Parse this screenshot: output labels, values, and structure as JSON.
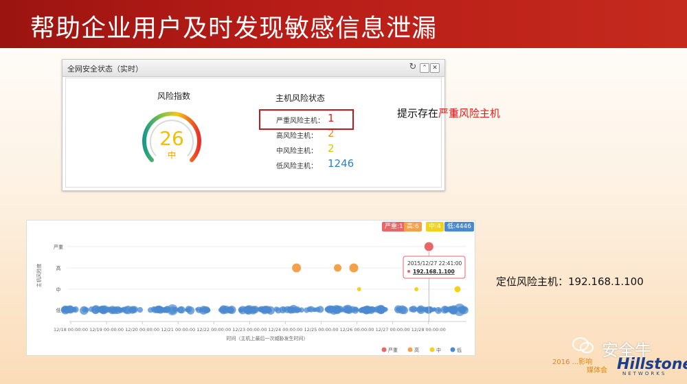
{
  "header": {
    "title": "帮助企业用户及时发现敏感信息泄漏"
  },
  "status_panel": {
    "title": "全网安全状态（实时）",
    "risk_index_label": "风险指数",
    "risk_value": "26",
    "risk_level": "中",
    "host_status_title": "主机风险状态",
    "rows": [
      {
        "label": "严重风险主机：",
        "value": "1",
        "color": "#e21b1b"
      },
      {
        "label": "高风险主机：",
        "value": "2",
        "color": "#f28a1c"
      },
      {
        "label": "中风险主机：",
        "value": "2",
        "color": "#e8c000"
      },
      {
        "label": "低风险主机：",
        "value": "1246",
        "color": "#2f7fc8"
      }
    ]
  },
  "note1": {
    "prefix": "提示存在",
    "highlight": "严重风险主机"
  },
  "note2": {
    "text": "定位风险主机：192.168.1.100"
  },
  "chart_data": {
    "type": "scatter",
    "badges": [
      {
        "text": "严重:1",
        "color": "#e8656a"
      },
      {
        "text": "高:6",
        "color": "#f5a04a"
      },
      {
        "text": "中:4",
        "color": "#f2d21a"
      },
      {
        "text": "低:4446",
        "color": "#4b8ad0"
      }
    ],
    "y_categories": [
      "低",
      "中",
      "高",
      "严重"
    ],
    "ylabel": "主机风险度",
    "xlabel": "时间（主机上最后一次威胁发生时间）",
    "x_ticks": [
      "12/18 00:00:00",
      "12/19 00:00:00",
      "12/20 00:00:00",
      "12/21 00:00:00",
      "12/22 00:00:00",
      "12/23 00:00:00",
      "12/24 00:00:00",
      "12/25 00:00:00",
      "12/26 00:00:00",
      "12/27 00:00:00",
      "12/28 00:00:00"
    ],
    "legend": [
      "严重",
      "高",
      "中",
      "低"
    ],
    "legend_colors": [
      "#e8656a",
      "#f5a04a",
      "#f2d21a",
      "#4b8ad0"
    ],
    "series": [
      {
        "name": "严重",
        "color": "#e8656a",
        "points": [
          {
            "x": 10.05,
            "size": 7
          }
        ]
      },
      {
        "name": "高",
        "color": "#f5a04a",
        "points": [
          {
            "x": 6.35,
            "size": 7
          },
          {
            "x": 7.5,
            "size": 6
          },
          {
            "x": 7.95,
            "size": 7
          }
        ]
      },
      {
        "name": "中",
        "color": "#f2d21a",
        "points": [
          {
            "x": 8.1,
            "size": 3.5
          },
          {
            "x": 9.7,
            "size": 3.5
          },
          {
            "x": 10.85,
            "size": 5
          }
        ]
      }
    ],
    "tooltip": {
      "time": "2015/12/27 22:41:00",
      "ip": "192.168.1.100"
    }
  },
  "watermark": {
    "name": "安全牛",
    "brand": "Hillstone",
    "brand_sub": "NETWORKS",
    "left1": "2016 ...影响",
    "left2": "媒体会"
  }
}
